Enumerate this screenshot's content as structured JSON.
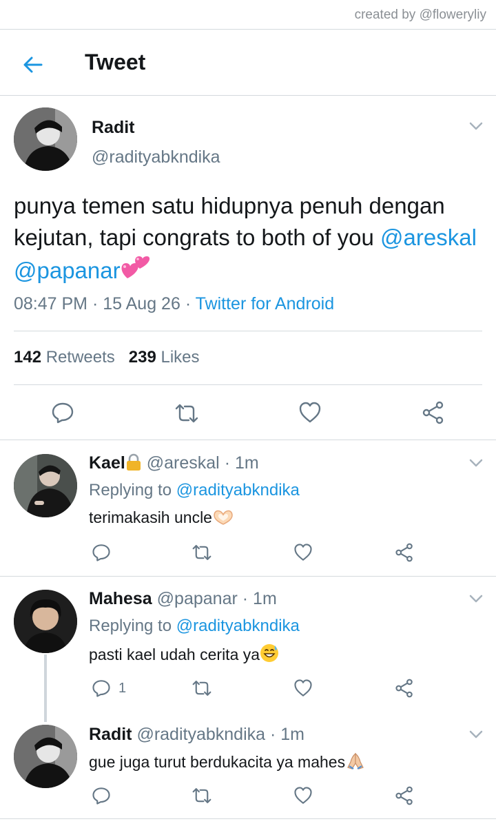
{
  "credit": "created by @floweryliy",
  "header": {
    "title": "Tweet"
  },
  "main_tweet": {
    "name": "Radit",
    "handle": "@radityabkndika",
    "text_before": "punya temen satu hidupnya penuh dengan kejutan, tapi congrats to both of you ",
    "mention1": "@areskal",
    "mention2": "@papanar",
    "time": "08:47 PM",
    "dot": "·",
    "date": "15 Aug 26",
    "source": "Twitter for Android",
    "retweets_count": "142",
    "retweets_label": "Retweets",
    "likes_count": "239",
    "likes_label": "Likes"
  },
  "replies": [
    {
      "name": "Kael",
      "handle": "@areskal",
      "time": "· 1m",
      "replying_label": "Replying to",
      "replying_to": "@radityabkndika",
      "text": "terimakasih uncle",
      "reply_count": ""
    },
    {
      "name": "Mahesa",
      "handle": "@papanar",
      "time": "· 1m",
      "replying_label": "Replying to",
      "replying_to": "@radityabkndika",
      "text": "pasti kael udah cerita ya",
      "reply_count": "1"
    },
    {
      "name": "Radit",
      "handle": "@radityabkndika",
      "time": "· 1m",
      "text": "gue juga turut berdukacita ya mahes",
      "reply_count": ""
    }
  ],
  "colors": {
    "accent": "#1b95e0",
    "muted": "#657786",
    "divider": "#d4d9dd"
  }
}
